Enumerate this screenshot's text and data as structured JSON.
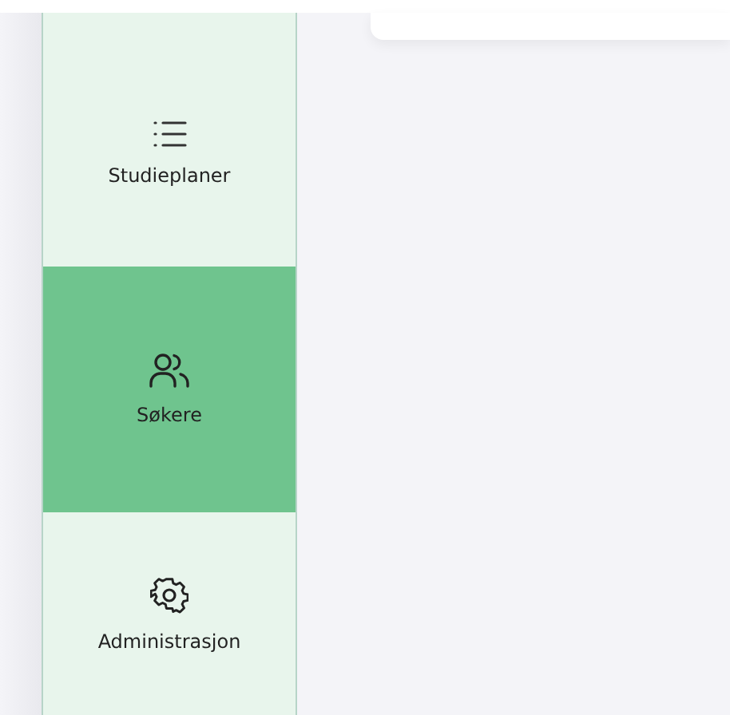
{
  "sidebar": {
    "items": [
      {
        "label": "Studieplaner",
        "kind": "list",
        "selected": false
      },
      {
        "label": "Søkere",
        "kind": "people",
        "selected": true
      },
      {
        "label": "Administrasjon",
        "kind": "gear",
        "selected": false
      }
    ]
  }
}
